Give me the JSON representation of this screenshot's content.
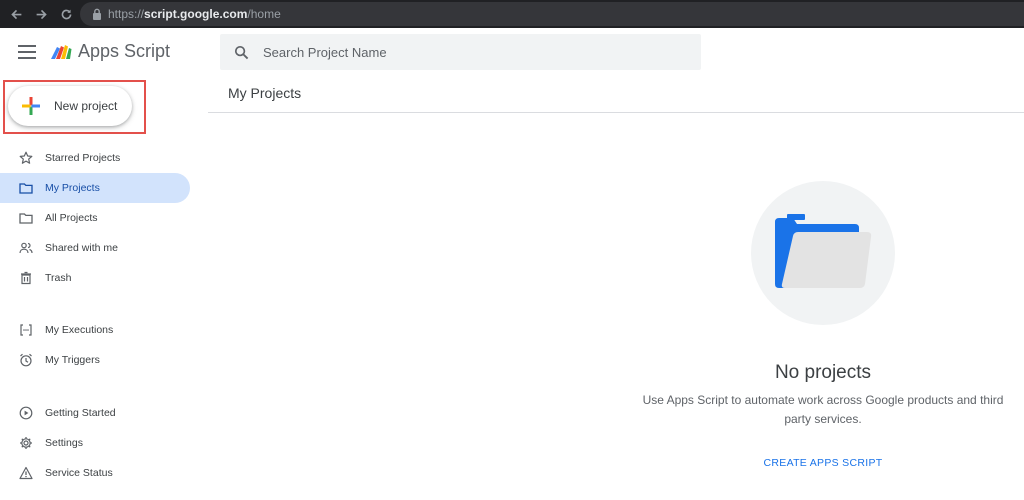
{
  "browser": {
    "url_scheme": "https://",
    "url_host": "script.google.com",
    "url_path": "/home"
  },
  "app": {
    "title": "Apps Script"
  },
  "new_project": {
    "label": "New project"
  },
  "nav": {
    "items": [
      {
        "label": "Starred Projects",
        "icon": "star-icon"
      },
      {
        "label": "My Projects",
        "icon": "folder-icon",
        "active": true
      },
      {
        "label": "All Projects",
        "icon": "folder-outline-icon"
      },
      {
        "label": "Shared with me",
        "icon": "people-icon"
      },
      {
        "label": "Trash",
        "icon": "trash-icon"
      },
      {
        "label": "My Executions",
        "icon": "executions-icon"
      },
      {
        "label": "My Triggers",
        "icon": "alarm-icon"
      },
      {
        "label": "Getting Started",
        "icon": "play-circle-icon"
      },
      {
        "label": "Settings",
        "icon": "gear-icon"
      },
      {
        "label": "Service Status",
        "icon": "warning-icon"
      }
    ]
  },
  "search": {
    "placeholder": "Search Project Name",
    "value": ""
  },
  "main": {
    "title": "My Projects",
    "empty_title": "No projects",
    "empty_description": "Use Apps Script to automate work across Google products and third party services.",
    "create_label": "CREATE APPS SCRIPT"
  },
  "colors": {
    "accent": "#1a73e8",
    "active_nav_bg": "#d2e3fc",
    "highlight_border": "#e3504b",
    "browser_bg": "#202124"
  }
}
